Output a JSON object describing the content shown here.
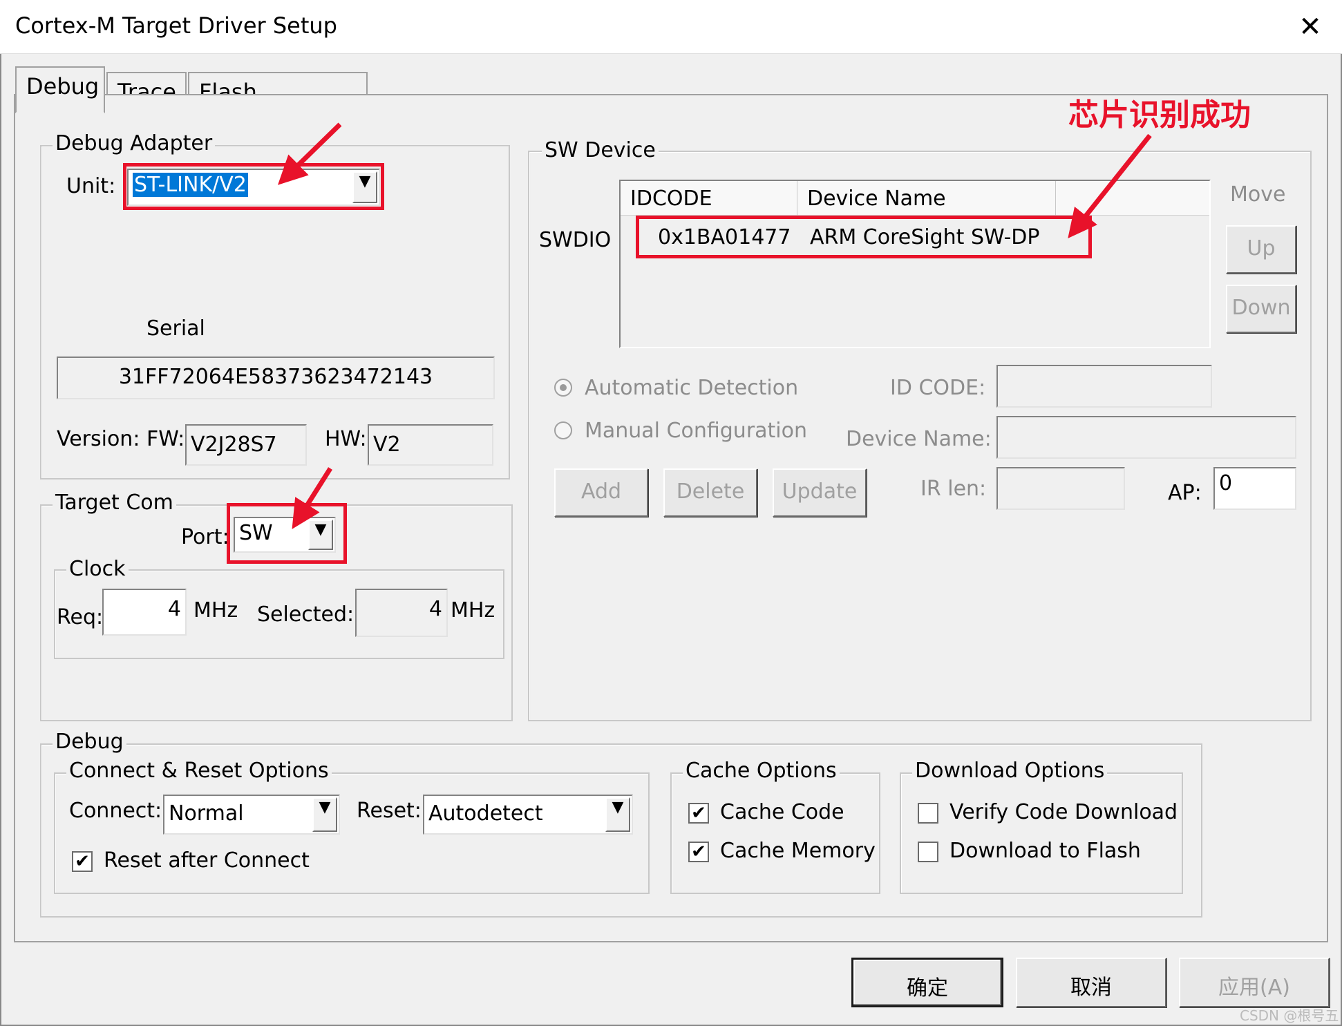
{
  "window": {
    "title": "Cortex-M Target Driver Setup"
  },
  "tabs": [
    {
      "label": "Debug"
    },
    {
      "label": "Trace"
    },
    {
      "label": "Flash Download"
    }
  ],
  "debug_adapter": {
    "legend": "Debug Adapter",
    "unit_label": "Unit:",
    "unit_value": "ST-LINK/V2",
    "serial_label": "Serial",
    "serial_value": "31FF72064E58373623472143",
    "version_label": "Version: FW:",
    "fw_value": "V2J28S7",
    "hw_label": "HW:",
    "hw_value": "V2"
  },
  "target_com": {
    "legend": "Target Com",
    "port_label": "Port:",
    "port_value": "SW",
    "clock_legend": "Clock",
    "req_label": "Req:",
    "req_value": "4",
    "mhz_unit": "MHz",
    "selected_label": "Selected:",
    "selected_value": "4"
  },
  "sw_device": {
    "legend": "SW Device",
    "swdio_label": "SWDIO",
    "columns": [
      "IDCODE",
      "Device Name"
    ],
    "rows": [
      {
        "idcode": "0x1BA01477",
        "device_name": "ARM CoreSight SW-DP"
      }
    ],
    "move_label": "Move",
    "up_label": "Up",
    "down_label": "Down",
    "auto_detect_label": "Automatic Detection",
    "manual_config_label": "Manual Configuration",
    "id_code_label": "ID CODE:",
    "device_name_label": "Device Name:",
    "add_label": "Add",
    "delete_label": "Delete",
    "update_label": "Update",
    "ir_len_label": "IR len:",
    "ap_label": "AP:",
    "ap_value": "0"
  },
  "debug": {
    "legend": "Debug",
    "connect_reset": {
      "legend": "Connect & Reset Options",
      "connect_label": "Connect:",
      "connect_value": "Normal",
      "reset_label": "Reset:",
      "reset_value": "Autodetect",
      "reset_after_connect_label": "Reset after Connect",
      "reset_after_connect_checked": true
    },
    "cache_options": {
      "legend": "Cache Options",
      "cache_code_label": "Cache Code",
      "cache_code_checked": true,
      "cache_memory_label": "Cache Memory",
      "cache_memory_checked": true
    },
    "download_options": {
      "legend": "Download Options",
      "verify_label": "Verify Code Download",
      "verify_checked": false,
      "download_flash_label": "Download to Flash",
      "download_flash_checked": false
    }
  },
  "buttons": {
    "ok": "确定",
    "cancel": "取消",
    "apply": "应用(A)"
  },
  "annotation": {
    "text": "芯片识别成功",
    "color": "#e8122a"
  },
  "watermark": "CSDN @根号五",
  "icons": {
    "close": "close-icon",
    "dropdown": "chevron-down-icon",
    "check": "check-icon"
  },
  "colors": {
    "accent": "#e8122a",
    "selection": "#0078d7",
    "dialog_bg": "#f0f0f0"
  }
}
